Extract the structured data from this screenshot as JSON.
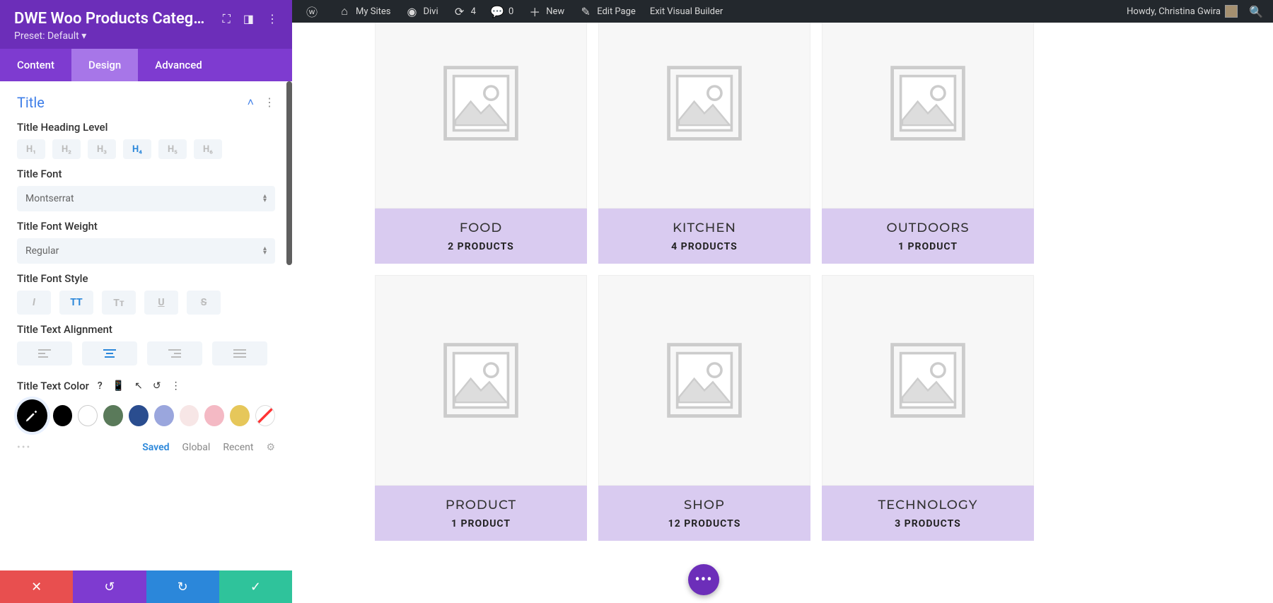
{
  "wp_admin": {
    "my_sites": "My Sites",
    "divi": "Divi",
    "updates_count": "4",
    "comments_count": "0",
    "new": "New",
    "edit_page": "Edit Page",
    "exit_vb": "Exit Visual Builder",
    "howdy": "Howdy, Christina Gwira"
  },
  "panel": {
    "title": "DWE Woo Products Catego...",
    "preset": "Preset: Default ▾",
    "tabs": {
      "content": "Content",
      "design": "Design",
      "advanced": "Advanced"
    },
    "section_title": "Title",
    "labels": {
      "heading_level": "Title Heading Level",
      "font": "Title Font",
      "font_weight": "Title Font Weight",
      "font_style": "Title Font Style",
      "alignment": "Title Text Alignment",
      "text_color": "Title Text Color"
    },
    "heading_levels": [
      "H₁",
      "H₂",
      "H₃",
      "H₄",
      "H₅",
      "H₆"
    ],
    "heading_active": 3,
    "font_value": "Montserrat",
    "font_weight_value": "Regular",
    "style_buttons": {
      "italic": "I",
      "uppercase": "TT",
      "smallcaps": "Tᴛ",
      "underline": "U",
      "strike": "S"
    },
    "style_active": "uppercase",
    "align_active": 1,
    "color_icons": {
      "help": "?",
      "responsive": "📱",
      "hover": "↖",
      "reset": "↺",
      "more": "⋮"
    },
    "swatches": [
      "#000000",
      "#ffffff",
      "#5a7a5a",
      "#2a4d8f",
      "#9aa6dd",
      "#f7e6e6",
      "#f4b9c4",
      "#e6c75a"
    ],
    "palette_tabs": {
      "saved": "Saved",
      "global": "Global",
      "recent": "Recent"
    }
  },
  "preview": {
    "fab_label": "•••",
    "cards": [
      {
        "title": "FOOD",
        "count": "2 PRODUCTS"
      },
      {
        "title": "KITCHEN",
        "count": "4 PRODUCTS"
      },
      {
        "title": "OUTDOORS",
        "count": "1 PRODUCT"
      },
      {
        "title": "PRODUCT",
        "count": "1 PRODUCT"
      },
      {
        "title": "SHOP",
        "count": "12 PRODUCTS"
      },
      {
        "title": "TECHNOLOGY",
        "count": "3 PRODUCTS"
      }
    ]
  }
}
